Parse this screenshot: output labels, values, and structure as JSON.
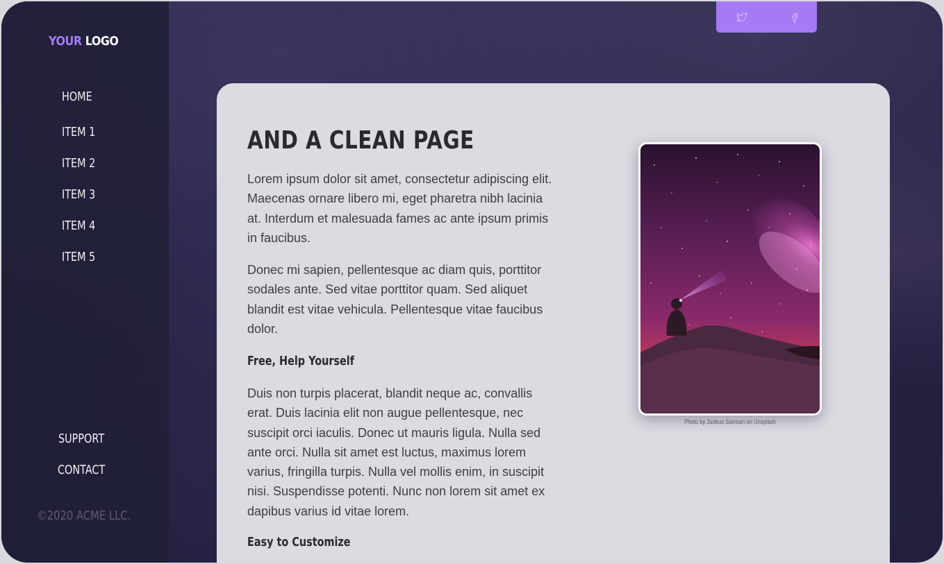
{
  "brand": {
    "logo_part1": "YOUR",
    "logo_part2": "LOGO",
    "accent_color": "#a57cf7"
  },
  "nav": {
    "items": [
      {
        "label": "HOME"
      },
      {
        "label": "ITEM 1"
      },
      {
        "label": "ITEM 2"
      },
      {
        "label": "ITEM 3"
      },
      {
        "label": "ITEM 4"
      },
      {
        "label": "ITEM 5"
      }
    ],
    "footer_items": [
      {
        "label": "SUPPORT"
      },
      {
        "label": "CONTACT"
      }
    ],
    "copyright": "©2020 ACME LLC."
  },
  "social": {
    "icons": [
      "twitter-icon",
      "facebook-icon"
    ],
    "color": "#a47af5"
  },
  "content": {
    "title": "AND A CLEAN PAGE",
    "paragraphs": [
      "Lorem ipsum dolor sit amet, consectetur adipiscing elit. Maecenas ornare libero mi, eget pharetra nibh lacinia at. Interdum et malesuada fames ac ante ipsum primis in faucibus.",
      "Donec mi sapien, pellentesque ac diam quis, porttitor sodales ante. Sed vitae porttitor quam. Sed aliquet blandit est vitae vehicula. Pellentesque vitae faucibus dolor.",
      "Duis non turpis placerat, blandit neque ac, convallis erat. Duis lacinia elit non augue pellentesque, nec suscipit orci iaculis. Donec ut mauris ligula. Nulla sed ante orci. Nulla sit amet est luctus, maximus lorem varius, fringilla turpis. Nulla vel mollis enim, in suscipit nisi. Suspendisse potenti. Nunc non lorem sit amet ex dapibus varius id vitae lorem."
    ],
    "subheadings": [
      "Free, Help Yourself",
      "Easy to Customize"
    ],
    "photo_caption": "Photo by Judeus Samson on Unsplash"
  }
}
